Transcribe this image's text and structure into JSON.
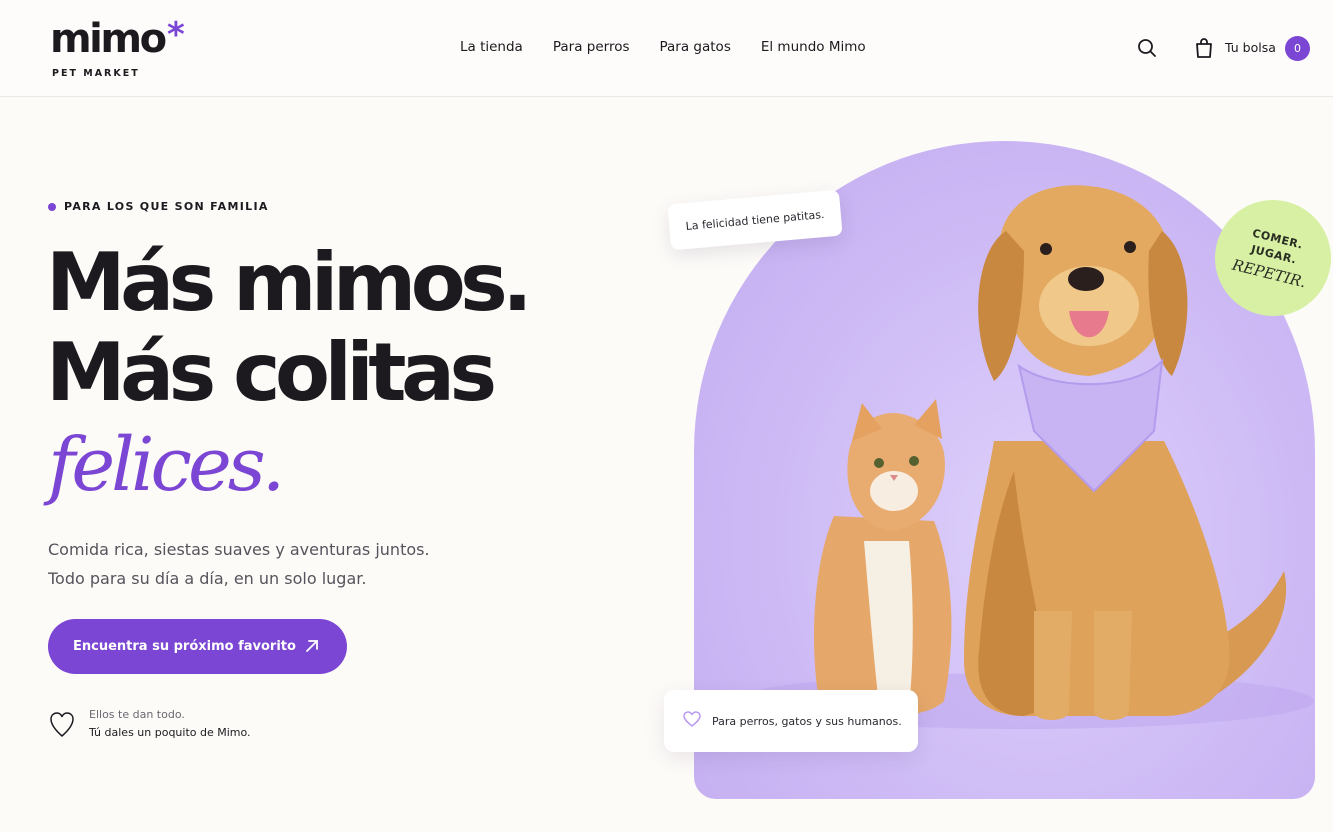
{
  "brand": {
    "name": "mimo",
    "mark": "*",
    "tagline": "PET MARKET",
    "accent": "#7b46d3"
  },
  "nav": {
    "items": [
      "La tienda",
      "Para perros",
      "Para gatos",
      "El mundo Mimo"
    ]
  },
  "header": {
    "bag_label": "Tu bolsa",
    "bag_count": "0"
  },
  "hero": {
    "eyebrow": "PARA LOS QUE SON FAMILIA",
    "headline": {
      "line1": "Más mimos.",
      "line2": "Más colitas",
      "line3": "felices."
    },
    "lead": {
      "line1": "Comida rica, siestas suaves y aventuras juntos.",
      "line2": "Todo para su día a día, en un solo lugar."
    },
    "cta": "Encuentra su próximo favorito",
    "note": {
      "line1": "Ellos te dan todo.",
      "line2": "Tú dales un poquito de Mimo."
    }
  },
  "visual": {
    "pill_top": "La felicidad tiene patitas.",
    "pill_bottom": "Para perros, gatos y sus humanos.",
    "badge": {
      "line1": "COMER.",
      "line2": "JUGAR.",
      "line3": "REPETIR."
    },
    "photo_subject": "golden retriever with lilac bandana and orange tabby cat",
    "badge_color": "#d7f0a4",
    "backdrop_color": "#cdbaf5"
  },
  "icons": [
    "search-icon",
    "bag-icon",
    "arrow-up-right-icon",
    "heart-icon"
  ]
}
